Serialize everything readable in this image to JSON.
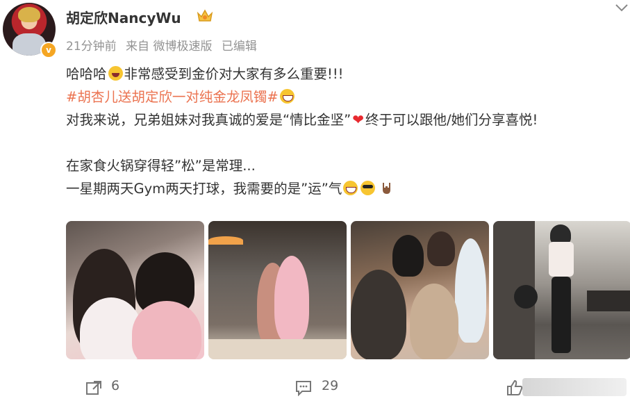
{
  "post": {
    "username": "胡定欣NancyWu",
    "meta": {
      "time": "21分钟前",
      "source": "来自 微博极速版",
      "edited": "已编辑"
    },
    "content": {
      "line1": "哈哈哈",
      "line1_rest": "非常感受到金价对大家有多么重要!!!",
      "topic": "#胡杏儿送胡定欣一对纯金龙凤镯#",
      "line3_a": "对我来说，兄弟姐妹对我真诚的爱是“情比金坚”",
      "line3_b": "终于可以跟他/她们分享喜悦!",
      "line5": "在家食火锅穿得轻”松”是常理...",
      "line6": "一星期两天Gym两天打球，我需要的是”运”气"
    },
    "footer": {
      "repost_count": "6",
      "comment_count": "29"
    }
  },
  "icons": {
    "verified_badge": "v",
    "accent": "#eb7350"
  }
}
